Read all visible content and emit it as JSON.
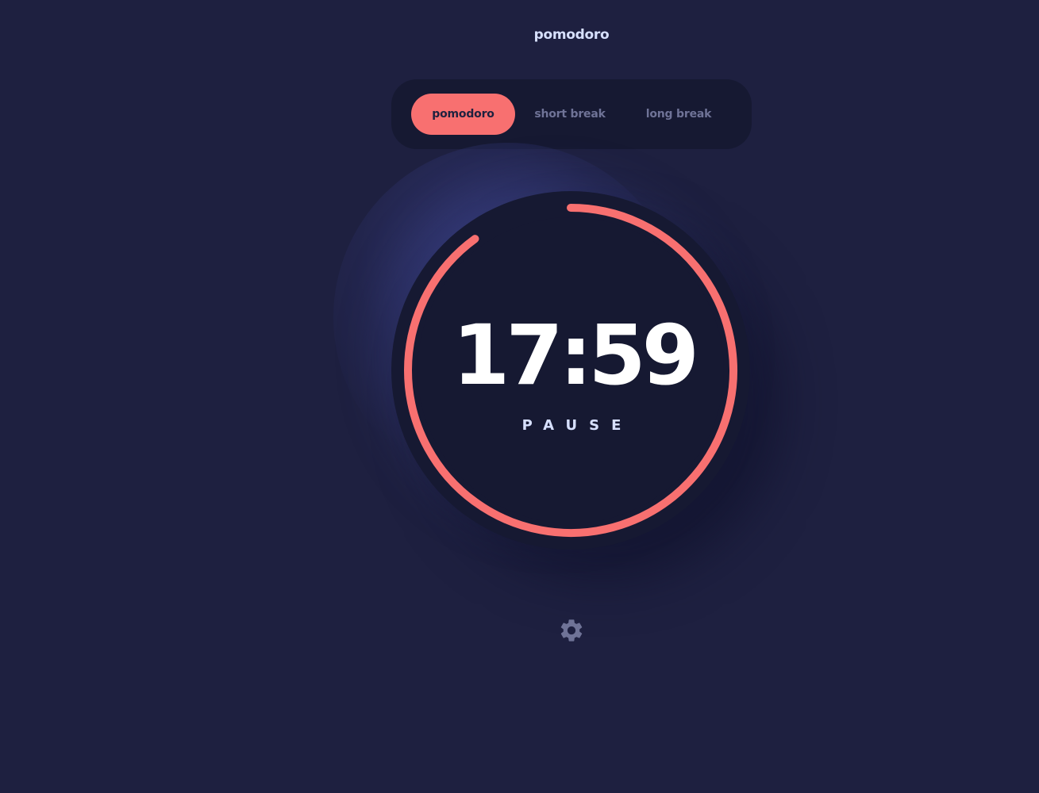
{
  "app": {
    "title": "pomodoro"
  },
  "modes": {
    "items": [
      {
        "label": "pomodoro",
        "active": true
      },
      {
        "label": "short break",
        "active": false
      },
      {
        "label": "long break",
        "active": false
      }
    ]
  },
  "timer": {
    "time": "17:59",
    "action_label": "PAUSE",
    "progress": 0.9
  },
  "icons": {
    "settings": "gear-icon"
  },
  "colors": {
    "background": "#1e2040",
    "panel": "#161932",
    "accent": "#f87070",
    "text_light": "#d7e0ff",
    "text_muted": "#6f7397"
  }
}
